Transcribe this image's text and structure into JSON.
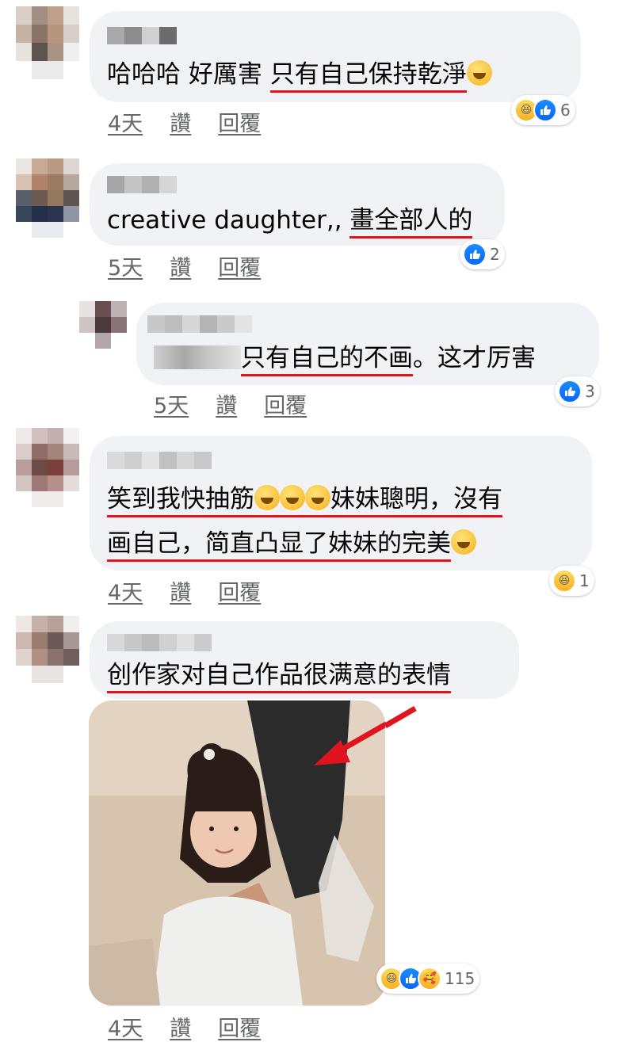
{
  "comments": [
    {
      "text_prefix": "哈哈哈  好厲害  ",
      "text_underlined": "只有自己保持乾淨",
      "emoji": "grinning-face",
      "time": "4天",
      "like_label": "讚",
      "reply_label": "回覆",
      "reactions": [
        "haha",
        "like"
      ],
      "reaction_count": "6"
    },
    {
      "text_prefix": "creative daughter,, ",
      "text_underlined": "畫全部人的",
      "time": "5天",
      "like_label": "讚",
      "reply_label": "回覆",
      "reactions": [
        "like"
      ],
      "reaction_count": "2"
    },
    {
      "is_reply": true,
      "text_underlined": "只有自己的不画",
      "text_suffix": "。这才厉害",
      "time": "5天",
      "like_label": "讚",
      "reply_label": "回覆",
      "reactions": [
        "like"
      ],
      "reaction_count": "3"
    },
    {
      "line1": "笑到我快抽筋",
      "line1_suffix": "妹妹聰明，沒有",
      "line2": "画自己，简直凸显了妹妹的完美",
      "emoji_line1": [
        "joy-face",
        "joy-face",
        "joy-face"
      ],
      "emoji_line2": "hand-over-mouth-face",
      "time": "4天",
      "like_label": "讚",
      "reply_label": "回覆",
      "reactions": [
        "haha"
      ],
      "reaction_count": "1"
    },
    {
      "text_underlined": "创作家对自己作品很满意的表情",
      "time": "4天",
      "like_label": "讚",
      "reply_label": "回覆",
      "reactions": [
        "haha",
        "like",
        "care"
      ],
      "reaction_count": "115"
    }
  ],
  "colors": {
    "bubble": "#f0f2f5",
    "underline": "#e0141e",
    "meta": "#65676b",
    "like_blue": "#0866ff",
    "arrow_red": "#e0141e"
  },
  "icons": {
    "like": "thumbs-up-icon",
    "haha": "laughing-face-icon",
    "care": "care-face-icon"
  }
}
